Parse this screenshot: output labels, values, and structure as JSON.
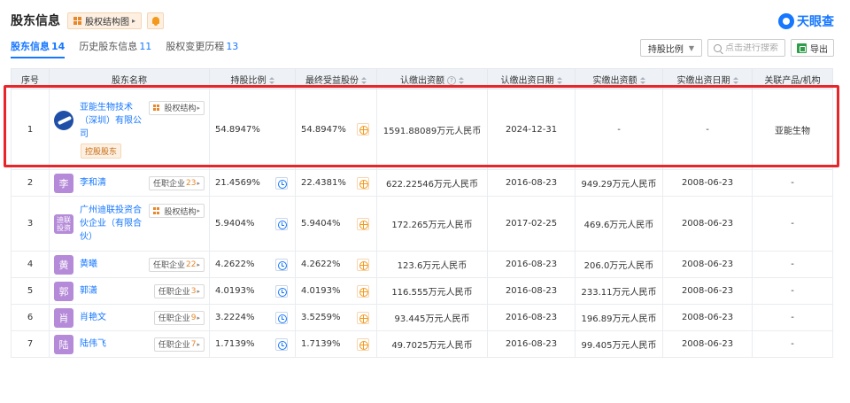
{
  "header": {
    "title": "股东信息",
    "equity_button": "股权结构图",
    "logo_text": "天眼查"
  },
  "tabs": [
    {
      "label": "股东信息",
      "count": "14"
    },
    {
      "label": "历史股东信息",
      "count": "11"
    },
    {
      "label": "股权变更历程",
      "count": "13"
    }
  ],
  "tools": {
    "ratio_select": "持股比例",
    "search_placeholder": "点击进行搜索",
    "export_label": "导出"
  },
  "table": {
    "columns": [
      "序号",
      "股东名称",
      "持股比例",
      "最终受益股份",
      "认缴出资额",
      "认缴出资日期",
      "实缴出资额",
      "实缴出资日期",
      "关联产品/机构"
    ],
    "rows": [
      {
        "no": "1",
        "avatar": "",
        "name": "亚能生物技术（深圳）有限公司",
        "tag": "股权结构",
        "tag_count": "",
        "extra_badge": "控股股东",
        "ratio": "54.8947%",
        "final": "54.8947%",
        "sub_amount": "1591.88089万元人民币",
        "sub_date": "2024-12-31",
        "paid_amount": "-",
        "paid_date": "-",
        "related": "亚能生物"
      },
      {
        "no": "2",
        "avatar": "李",
        "name": "李和清",
        "tag": "任职企业",
        "tag_count": "23",
        "extra_badge": "",
        "ratio": "21.4569%",
        "final": "22.4381%",
        "sub_amount": "622.22546万元人民币",
        "sub_date": "2016-08-23",
        "paid_amount": "949.29万元人民币",
        "paid_date": "2008-06-23",
        "related": "-"
      },
      {
        "no": "3",
        "avatar": "迪联投资",
        "name": "广州迪联投资合伙企业（有限合伙）",
        "tag": "股权结构",
        "tag_count": "",
        "extra_badge": "",
        "ratio": "5.9404%",
        "final": "5.9404%",
        "sub_amount": "172.265万元人民币",
        "sub_date": "2017-02-25",
        "paid_amount": "469.6万元人民币",
        "paid_date": "2008-06-23",
        "related": "-"
      },
      {
        "no": "4",
        "avatar": "黄",
        "name": "黄曦",
        "tag": "任职企业",
        "tag_count": "22",
        "extra_badge": "",
        "ratio": "4.2622%",
        "final": "4.2622%",
        "sub_amount": "123.6万元人民币",
        "sub_date": "2016-08-23",
        "paid_amount": "206.0万元人民币",
        "paid_date": "2008-06-23",
        "related": "-"
      },
      {
        "no": "5",
        "avatar": "郭",
        "name": "郭潇",
        "tag": "任职企业",
        "tag_count": "3",
        "extra_badge": "",
        "ratio": "4.0193%",
        "final": "4.0193%",
        "sub_amount": "116.555万元人民币",
        "sub_date": "2016-08-23",
        "paid_amount": "233.11万元人民币",
        "paid_date": "2008-06-23",
        "related": "-"
      },
      {
        "no": "6",
        "avatar": "肖",
        "name": "肖艳文",
        "tag": "任职企业",
        "tag_count": "9",
        "extra_badge": "",
        "ratio": "3.2224%",
        "final": "3.5259%",
        "sub_amount": "93.445万元人民币",
        "sub_date": "2016-08-23",
        "paid_amount": "196.89万元人民币",
        "paid_date": "2008-06-23",
        "related": "-"
      },
      {
        "no": "7",
        "avatar": "陆",
        "name": "陆伟飞",
        "tag": "任职企业",
        "tag_count": "7",
        "extra_badge": "",
        "ratio": "1.7139%",
        "final": "1.7139%",
        "sub_amount": "49.7025万元人民币",
        "sub_date": "2016-08-23",
        "paid_amount": "99.405万元人民币",
        "paid_date": "2008-06-23",
        "related": "-"
      }
    ]
  },
  "colors": {
    "accent": "#1677ff",
    "highlight": "#e8262a",
    "avatar_purple": "#b58ad8",
    "badge_orange": "#e8862a"
  }
}
